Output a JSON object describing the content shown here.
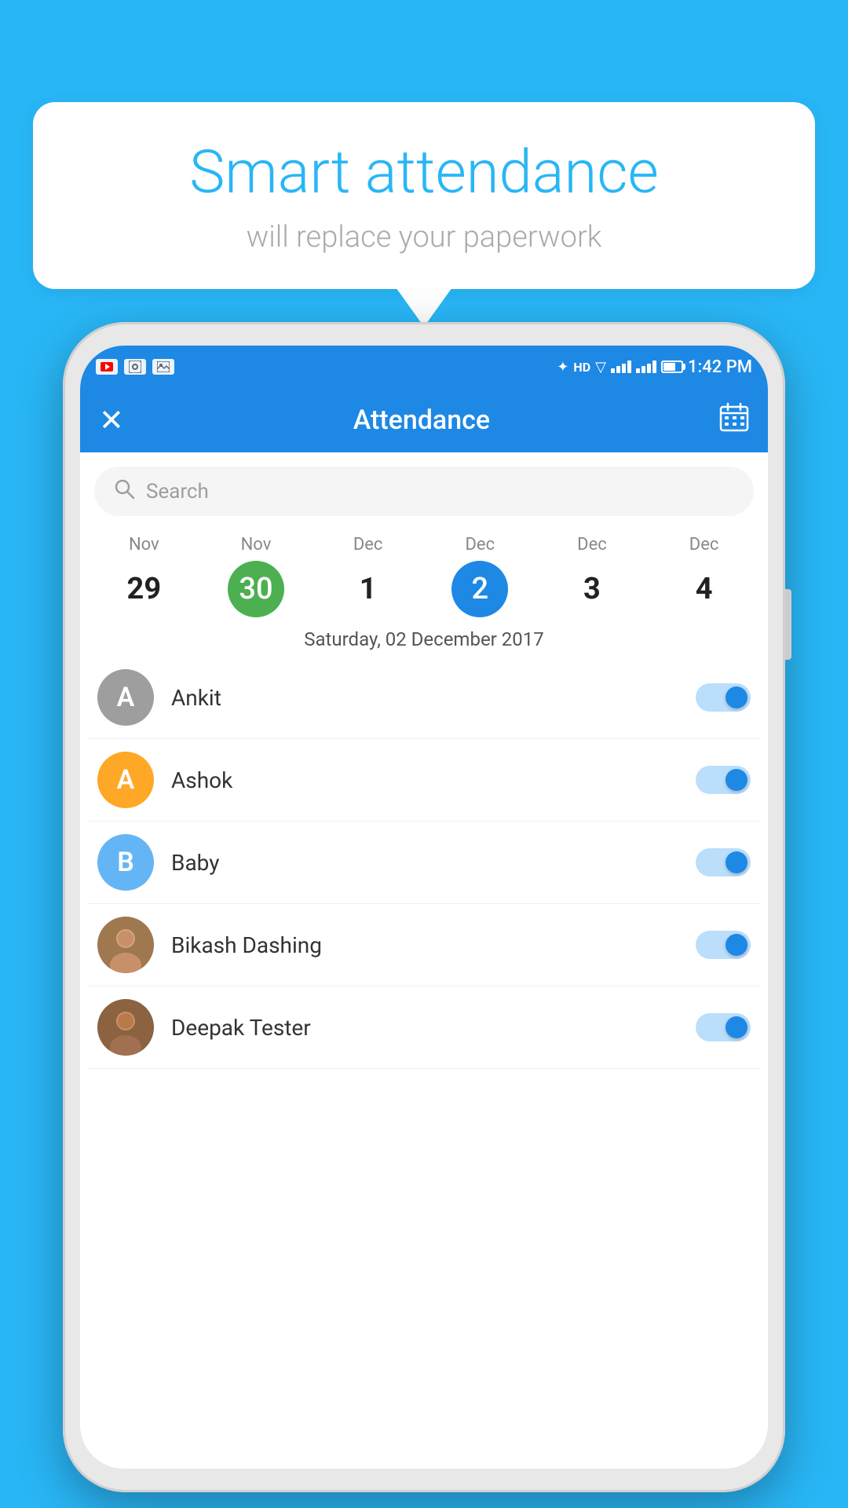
{
  "background_color": "#29b6f6",
  "speech_bubble": {
    "title": "Smart attendance",
    "subtitle": "will replace your paperwork"
  },
  "status_bar": {
    "time": "1:42 PM",
    "network": "HD"
  },
  "app_header": {
    "title": "Attendance",
    "close_label": "×",
    "calendar_label": "📅"
  },
  "search": {
    "placeholder": "Search"
  },
  "dates": [
    {
      "month": "Nov",
      "day": "29",
      "style": ""
    },
    {
      "month": "Nov",
      "day": "30",
      "style": "green"
    },
    {
      "month": "Dec",
      "day": "1",
      "style": ""
    },
    {
      "month": "Dec",
      "day": "2",
      "style": "blue"
    },
    {
      "month": "Dec",
      "day": "3",
      "style": ""
    },
    {
      "month": "Dec",
      "day": "4",
      "style": ""
    }
  ],
  "selected_date_label": "Saturday, 02 December 2017",
  "attendance_items": [
    {
      "id": 1,
      "name": "Ankit",
      "avatar_letter": "A",
      "avatar_style": "gray",
      "toggle_on": true
    },
    {
      "id": 2,
      "name": "Ashok",
      "avatar_letter": "A",
      "avatar_style": "orange",
      "toggle_on": true
    },
    {
      "id": 3,
      "name": "Baby",
      "avatar_letter": "B",
      "avatar_style": "light-blue",
      "toggle_on": true
    },
    {
      "id": 4,
      "name": "Bikash Dashing",
      "avatar_letter": "",
      "avatar_style": "photo-1",
      "toggle_on": true
    },
    {
      "id": 5,
      "name": "Deepak Tester",
      "avatar_letter": "",
      "avatar_style": "photo-2",
      "toggle_on": true
    }
  ]
}
